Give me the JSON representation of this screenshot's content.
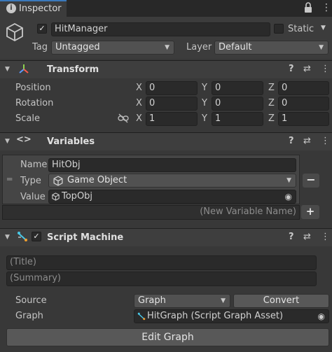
{
  "tab": {
    "title": "Inspector"
  },
  "object": {
    "name": "HitManager",
    "static_label": "Static",
    "tag_label": "Tag",
    "tag_value": "Untagged",
    "layer_label": "Layer",
    "layer_value": "Default"
  },
  "transform": {
    "title": "Transform",
    "position_label": "Position",
    "rotation_label": "Rotation",
    "scale_label": "Scale",
    "x": "X",
    "y": "Y",
    "z": "Z",
    "position": [
      "0",
      "0",
      "0"
    ],
    "rotation": [
      "0",
      "0",
      "0"
    ],
    "scale": [
      "1",
      "1",
      "1"
    ]
  },
  "variables": {
    "title": "Variables",
    "name_label": "Name",
    "name_value": "HitObj",
    "type_label": "Type",
    "type_value": "Game Object",
    "value_label": "Value",
    "value_value": "TopObj",
    "new_placeholder": "(New Variable Name)",
    "remove": "−",
    "add": "+"
  },
  "script_machine": {
    "title": "Script Machine",
    "title_placeholder": "(Title)",
    "summary_placeholder": "(Summary)",
    "source_label": "Source",
    "source_value": "Graph",
    "convert_label": "Convert",
    "graph_label": "Graph",
    "graph_value": "HitGraph (Script Graph Asset)",
    "edit_label": "Edit Graph"
  },
  "icons": {
    "info": "ℹ",
    "lock": "🔒",
    "menu": "⋮",
    "help": "?",
    "preset": "⇄",
    "check": "✓",
    "target": "◉"
  }
}
